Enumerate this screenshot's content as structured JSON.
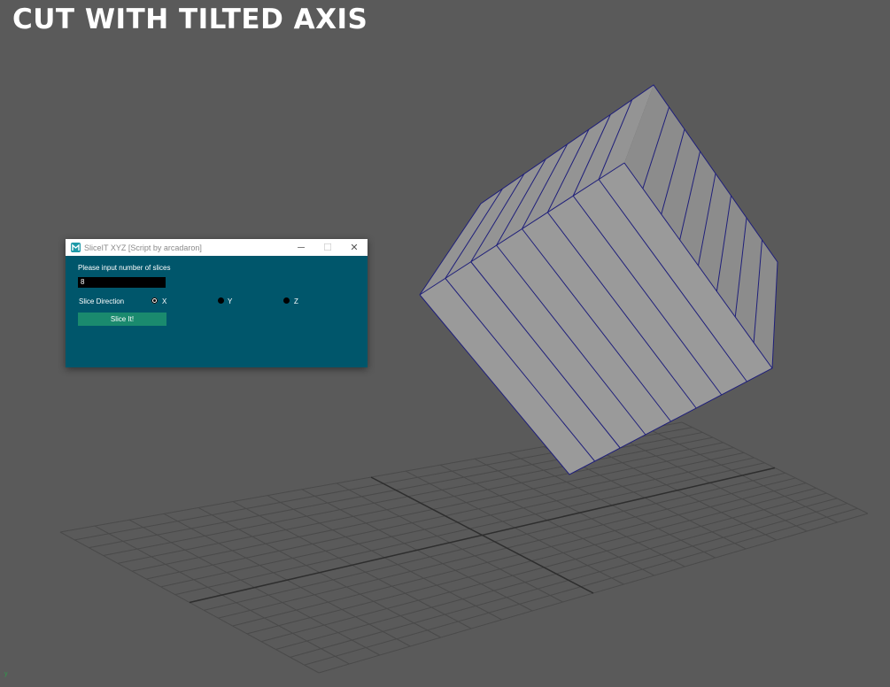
{
  "banner": {
    "text": "CUT WITH TILTED AXIS"
  },
  "dialog": {
    "title": "SliceIT XYZ [Script by arcadaron]",
    "controls": {
      "minimize": "─",
      "maximize": "☐",
      "close": "✕"
    },
    "prompt_label": "Please input number of slices",
    "slices_value": "8",
    "direction_label": "Slice Direction",
    "directions": [
      {
        "label": "X",
        "selected": true
      },
      {
        "label": "Y",
        "selected": false
      },
      {
        "label": "Z",
        "selected": false
      }
    ],
    "slice_button": "Slice It!"
  },
  "viewport": {
    "axis_marker": "y"
  },
  "colors": {
    "viewport_bg": "#5a5a5a",
    "dialog_bg": "#00566b",
    "button": "#1a8a6e",
    "wire": "#1f1f7a"
  },
  "icons": [
    "maya-app-icon",
    "minimize-icon",
    "maximize-icon",
    "close-icon",
    "radio-selected",
    "radio-unselected"
  ]
}
